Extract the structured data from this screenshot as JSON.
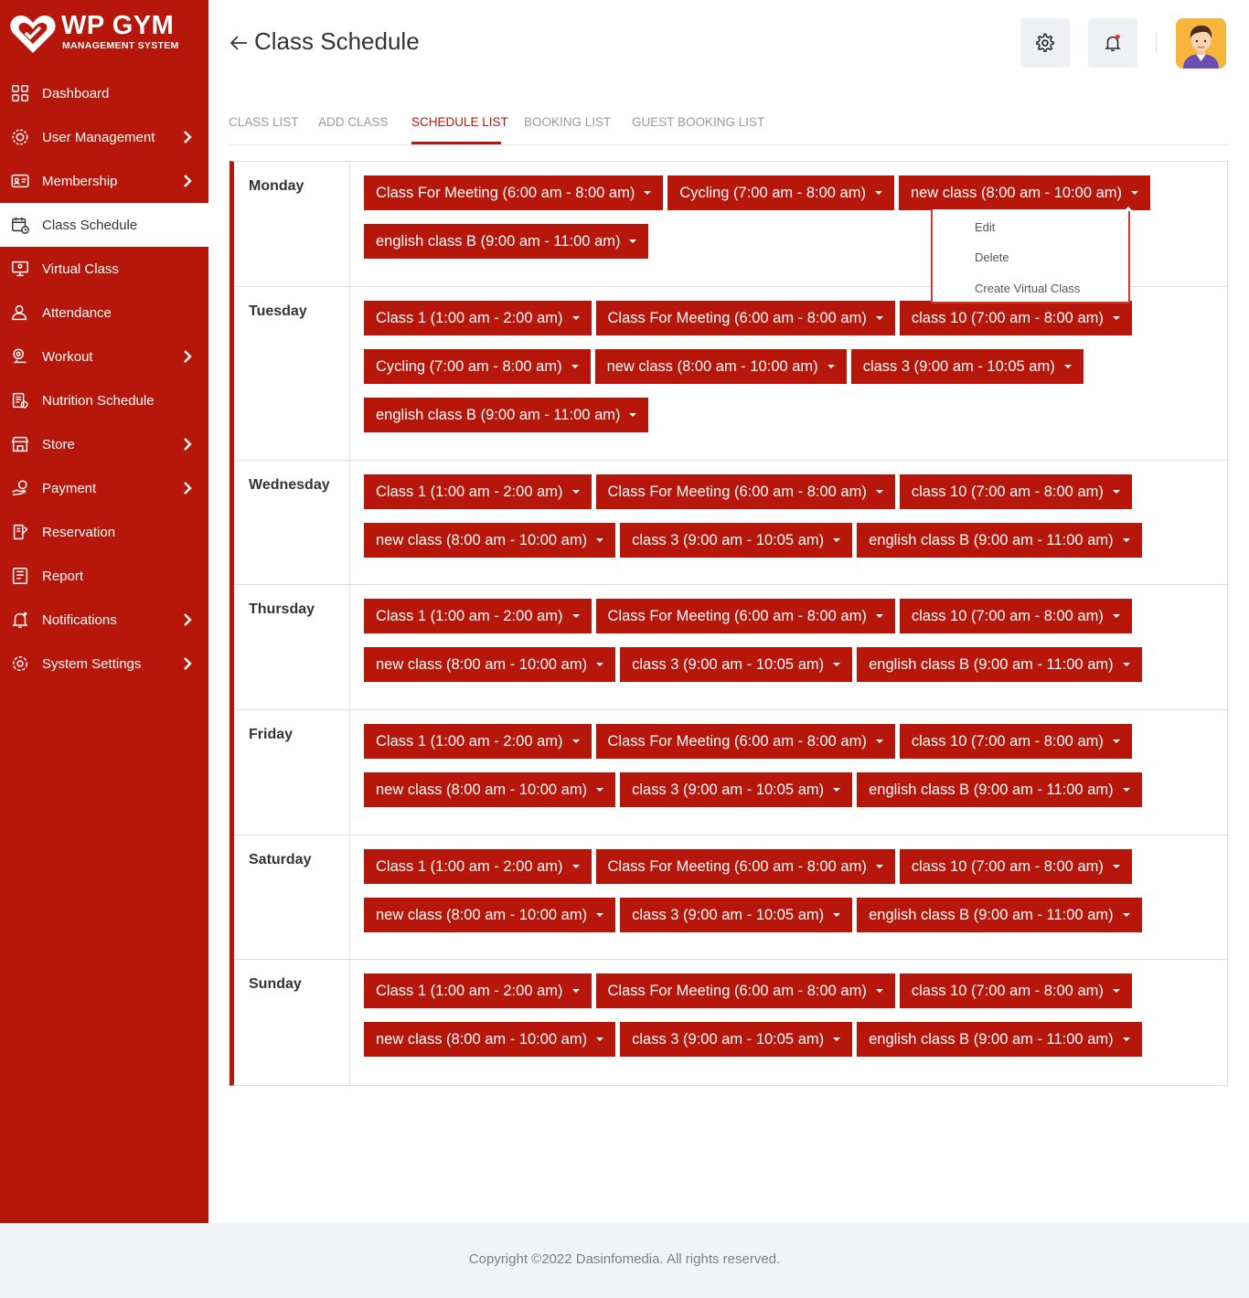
{
  "brand": {
    "name": "WP GYM",
    "tagline": "MANAGEMENT SYSTEM"
  },
  "colors": {
    "primary": "#b7160b",
    "sidebar_text": "#ffffff",
    "tab_inactive": "#9a9a9a"
  },
  "sidebar": {
    "items": [
      {
        "label": "Dashboard",
        "icon": "dashboard-icon",
        "has_submenu": false,
        "active": false
      },
      {
        "label": "User Management",
        "icon": "users-gear-icon",
        "has_submenu": true,
        "active": false
      },
      {
        "label": "Membership",
        "icon": "membership-card-icon",
        "has_submenu": true,
        "active": false
      },
      {
        "label": "Class Schedule",
        "icon": "calendar-icon",
        "has_submenu": false,
        "active": true
      },
      {
        "label": "Virtual Class",
        "icon": "virtual-class-icon",
        "has_submenu": false,
        "active": false
      },
      {
        "label": "Attendance",
        "icon": "attendance-icon",
        "has_submenu": false,
        "active": false
      },
      {
        "label": "Workout",
        "icon": "workout-icon",
        "has_submenu": true,
        "active": false
      },
      {
        "label": "Nutrition Schedule",
        "icon": "nutrition-icon",
        "has_submenu": false,
        "active": false
      },
      {
        "label": "Store",
        "icon": "store-icon",
        "has_submenu": true,
        "active": false
      },
      {
        "label": "Payment",
        "icon": "payment-icon",
        "has_submenu": true,
        "active": false
      },
      {
        "label": "Reservation",
        "icon": "reservation-icon",
        "has_submenu": false,
        "active": false
      },
      {
        "label": "Report",
        "icon": "report-icon",
        "has_submenu": false,
        "active": false
      },
      {
        "label": "Notifications",
        "icon": "bell-icon",
        "has_submenu": true,
        "active": false
      },
      {
        "label": "System Settings",
        "icon": "gear-icon",
        "has_submenu": true,
        "active": false
      }
    ]
  },
  "header": {
    "title": "Class Schedule"
  },
  "tabs": [
    {
      "label": "CLASS LIST",
      "active": false
    },
    {
      "label": "ADD CLASS",
      "active": false
    },
    {
      "label": "SCHEDULE LIST",
      "active": true
    },
    {
      "label": "BOOKING LIST",
      "active": false
    },
    {
      "label": "GUEST BOOKING LIST",
      "active": false
    }
  ],
  "schedule": [
    {
      "day": "Monday",
      "classes": [
        "Class For Meeting (6:00 am - 8:00 am)",
        "Cycling (7:00 am - 8:00 am)",
        "new class (8:00 am - 10:00 am)",
        "english class B (9:00 am - 11:00 am)"
      ]
    },
    {
      "day": "Tuesday",
      "classes": [
        "Class 1 (1:00 am - 2:00 am)",
        "Class For Meeting (6:00 am - 8:00 am)",
        "class 10 (7:00 am - 8:00 am)",
        "Cycling (7:00 am - 8:00 am)",
        "new class (8:00 am - 10:00 am)",
        "class 3 (9:00 am - 10:05 am)",
        "english class B (9:00 am - 11:00 am)"
      ]
    },
    {
      "day": "Wednesday",
      "classes": [
        "Class 1 (1:00 am - 2:00 am)",
        "Class For Meeting (6:00 am - 8:00 am)",
        "class 10 (7:00 am - 8:00 am)",
        "new class (8:00 am - 10:00 am)",
        "class 3 (9:00 am - 10:05 am)",
        "english class B (9:00 am - 11:00 am)"
      ]
    },
    {
      "day": "Thursday",
      "classes": [
        "Class 1 (1:00 am - 2:00 am)",
        "Class For Meeting (6:00 am - 8:00 am)",
        "class 10 (7:00 am - 8:00 am)",
        "new class (8:00 am - 10:00 am)",
        "class 3 (9:00 am - 10:05 am)",
        "english class B (9:00 am - 11:00 am)"
      ]
    },
    {
      "day": "Friday",
      "classes": [
        "Class 1 (1:00 am - 2:00 am)",
        "Class For Meeting (6:00 am - 8:00 am)",
        "class 10 (7:00 am - 8:00 am)",
        "new class (8:00 am - 10:00 am)",
        "class 3 (9:00 am - 10:05 am)",
        "english class B (9:00 am - 11:00 am)"
      ]
    },
    {
      "day": "Saturday",
      "classes": [
        "Class 1 (1:00 am - 2:00 am)",
        "Class For Meeting (6:00 am - 8:00 am)",
        "class 10 (7:00 am - 8:00 am)",
        "new class (8:00 am - 10:00 am)",
        "class 3 (9:00 am - 10:05 am)",
        "english class B (9:00 am - 11:00 am)"
      ]
    },
    {
      "day": "Sunday",
      "classes": [
        "Class 1 (1:00 am - 2:00 am)",
        "Class For Meeting (6:00 am - 8:00 am)",
        "class 10 (7:00 am - 8:00 am)",
        "new class (8:00 am - 10:00 am)",
        "class 3 (9:00 am - 10:05 am)",
        "english class B (9:00 am - 11:00 am)"
      ]
    }
  ],
  "dropdown_menu": {
    "items": [
      "Edit",
      "Delete",
      "Create Virtual Class"
    ]
  },
  "footer": {
    "copyright": "Copyright ©2022 Dasinfomedia. All rights reserved."
  }
}
